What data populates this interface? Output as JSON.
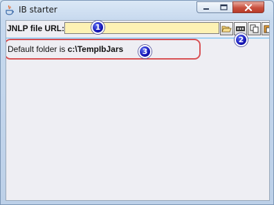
{
  "window": {
    "title": "IB starter",
    "controls": {
      "minimize": "minimize",
      "maximize": "maximize",
      "close": "close"
    }
  },
  "toolbar": {
    "url_label": "JNLP file URL:",
    "url_value": "",
    "buttons": [
      "open-folder-icon",
      "connect-icon",
      "copy-icon",
      "paste-icon"
    ]
  },
  "info": {
    "prefix": "Default folder is ",
    "folder": "c:\\TempIbJars"
  },
  "callouts": {
    "one": "1",
    "two": "2",
    "three": "3"
  },
  "colors": {
    "input_bg": "#fdf2b4",
    "callout_outline": "#d84f52",
    "badge": "#1616b8",
    "close_button": "#c9513f"
  }
}
